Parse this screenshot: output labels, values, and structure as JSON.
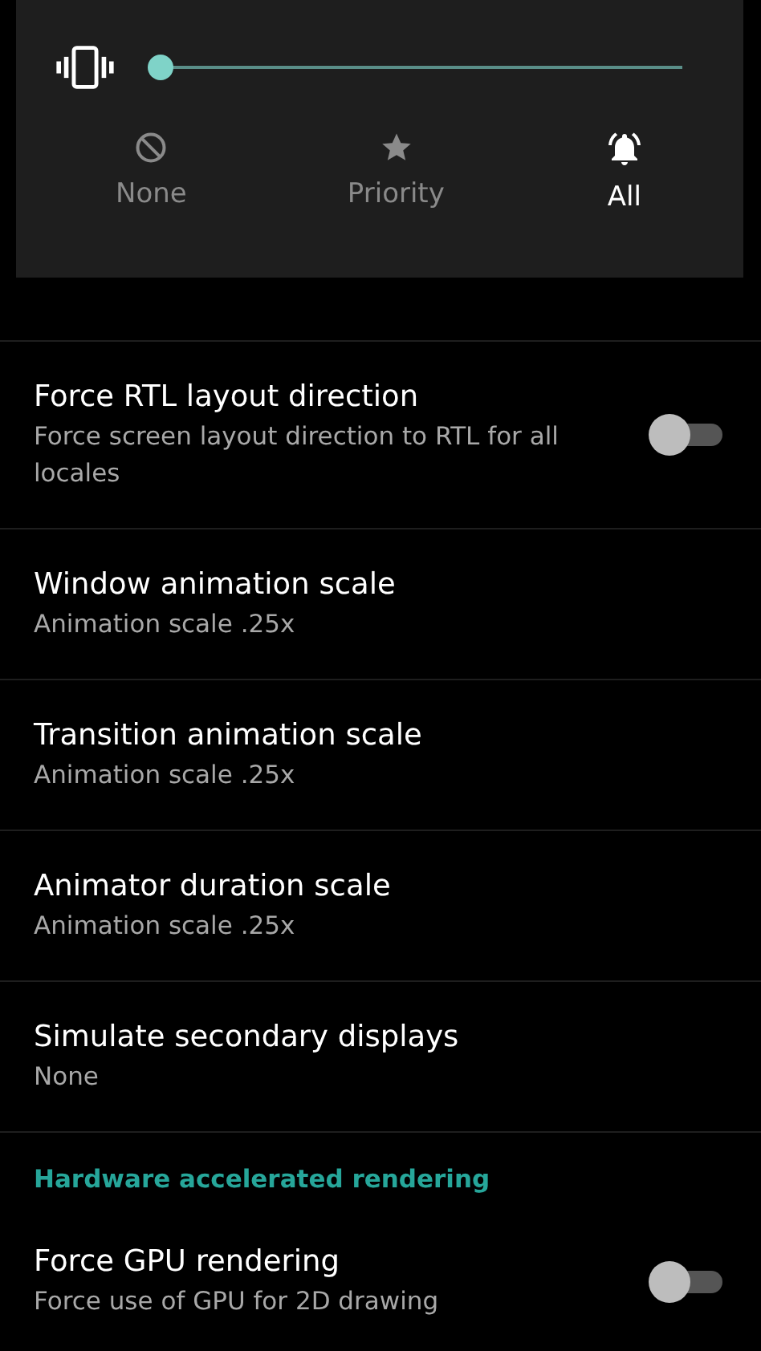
{
  "volume_panel": {
    "slider": {
      "level": 0
    },
    "modes": [
      {
        "label": "None",
        "kind": "none",
        "selected": false
      },
      {
        "label": "Priority",
        "kind": "priority",
        "selected": false
      },
      {
        "label": "All",
        "kind": "all",
        "selected": true
      }
    ]
  },
  "settings": [
    {
      "kind": "setting",
      "title": "Force RTL layout direction",
      "summary": "Force screen layout direction to RTL for all locales",
      "toggle": {
        "on": false
      }
    },
    {
      "kind": "setting",
      "title": "Window animation scale",
      "summary": "Animation scale .25x"
    },
    {
      "kind": "setting",
      "title": "Transition animation scale",
      "summary": "Animation scale .25x"
    },
    {
      "kind": "setting",
      "title": "Animator duration scale",
      "summary": "Animation scale .25x"
    },
    {
      "kind": "setting",
      "title": "Simulate secondary displays",
      "summary": "None"
    },
    {
      "kind": "header",
      "title": "Hardware accelerated rendering"
    },
    {
      "kind": "setting",
      "title": "Force GPU rendering",
      "summary": "Force use of GPU for 2D drawing",
      "toggle": {
        "on": false
      }
    }
  ]
}
